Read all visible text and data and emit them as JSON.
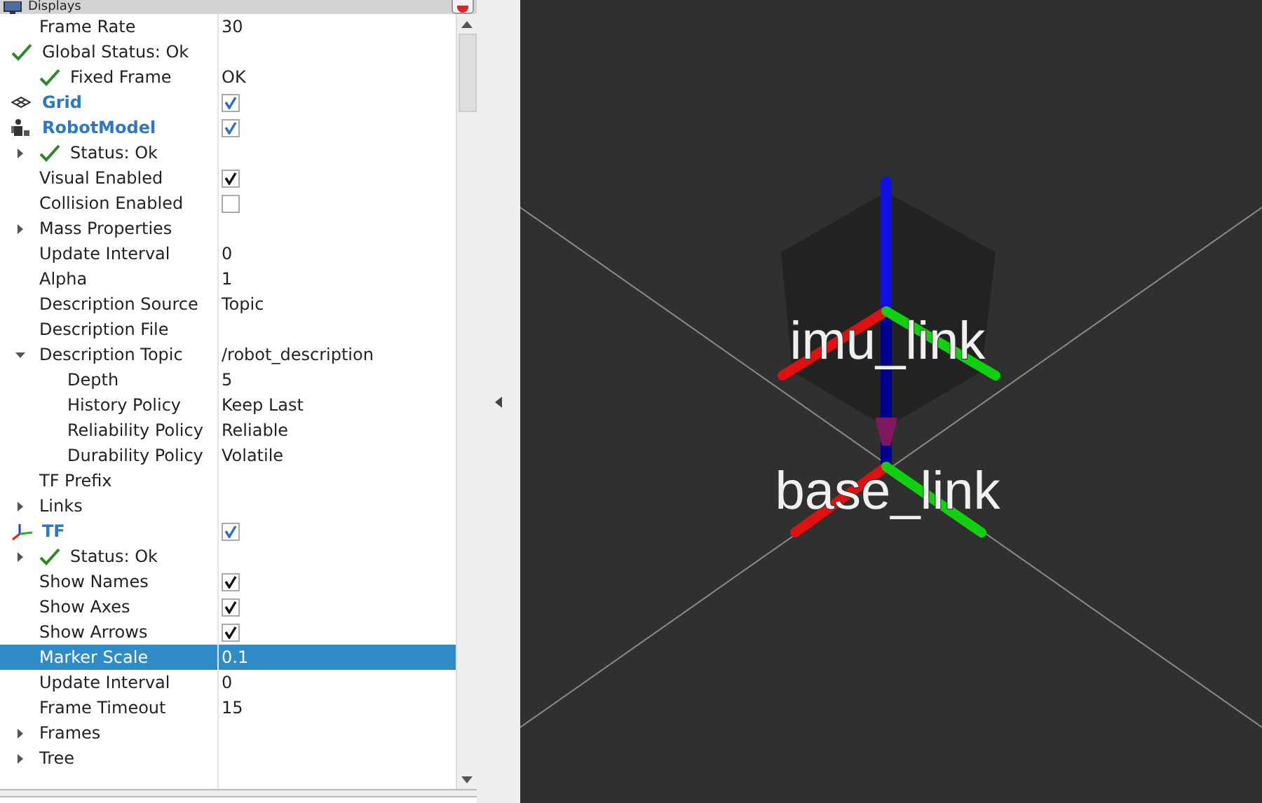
{
  "panel": {
    "title": "Displays"
  },
  "scrolled_rows": [
    {
      "kind": "property",
      "label": "Frame Rate",
      "value": "30",
      "selected": false
    }
  ],
  "displays": [
    {
      "kind": "status",
      "label": "Global Status: Ok",
      "selected": false,
      "children": [
        {
          "kind": "status",
          "label": "Fixed Frame",
          "value": "OK",
          "selected": false
        }
      ]
    },
    {
      "kind": "display",
      "label": "Grid",
      "checked": true,
      "selected": false
    },
    {
      "kind": "display",
      "label": "RobotModel",
      "checked": true,
      "selected": false,
      "children": [
        {
          "kind": "status",
          "label": "Status: Ok",
          "expanded": false,
          "selected": false
        },
        {
          "kind": "property",
          "label": "Visual Enabled",
          "checked": true,
          "selected": false
        },
        {
          "kind": "property",
          "label": "Collision Enabled",
          "checked": false,
          "selected": false
        },
        {
          "kind": "property",
          "label": "Mass Properties",
          "expanded": false,
          "selected": false
        },
        {
          "kind": "property",
          "label": "Update Interval",
          "value": "0",
          "selected": false
        },
        {
          "kind": "property",
          "label": "Alpha",
          "value": "1",
          "selected": false
        },
        {
          "kind": "property",
          "label": "Description Source",
          "value": "Topic",
          "selected": false
        },
        {
          "kind": "property",
          "label": "Description File",
          "selected": false
        },
        {
          "kind": "property",
          "label": "Description Topic",
          "value": "/robot_description",
          "expanded": true,
          "selected": false,
          "children": [
            {
              "kind": "property",
              "label": "Depth",
              "value": "5",
              "selected": false
            },
            {
              "kind": "property",
              "label": "History Policy",
              "value": "Keep Last",
              "selected": false
            },
            {
              "kind": "property",
              "label": "Reliability Policy",
              "value": "Reliable",
              "selected": false
            },
            {
              "kind": "property",
              "label": "Durability Policy",
              "value": "Volatile",
              "selected": false
            }
          ]
        },
        {
          "kind": "property",
          "label": "TF Prefix",
          "selected": false
        },
        {
          "kind": "property",
          "label": "Links",
          "expanded": false,
          "selected": false
        }
      ]
    },
    {
      "kind": "display",
      "label": "TF",
      "checked": true,
      "selected": false,
      "children": [
        {
          "kind": "status",
          "label": "Status: Ok",
          "expanded": false,
          "selected": false
        },
        {
          "kind": "property",
          "label": "Show Names",
          "checked": true,
          "selected": false
        },
        {
          "kind": "property",
          "label": "Show Axes",
          "checked": true,
          "selected": false
        },
        {
          "kind": "property",
          "label": "Show Arrows",
          "checked": true,
          "selected": false
        },
        {
          "kind": "property",
          "label": "Marker Scale",
          "value": "0.1",
          "selected": true
        },
        {
          "kind": "property",
          "label": "Update Interval",
          "value": "0",
          "selected": false
        },
        {
          "kind": "property",
          "label": "Frame Timeout",
          "value": "15",
          "selected": false
        },
        {
          "kind": "property",
          "label": "Frames",
          "expanded": false,
          "selected": false
        },
        {
          "kind": "property",
          "label": "Tree",
          "expanded": false,
          "selected": false
        }
      ]
    }
  ],
  "viewport": {
    "frame_labels": [
      "imu_link",
      "base_link"
    ]
  }
}
